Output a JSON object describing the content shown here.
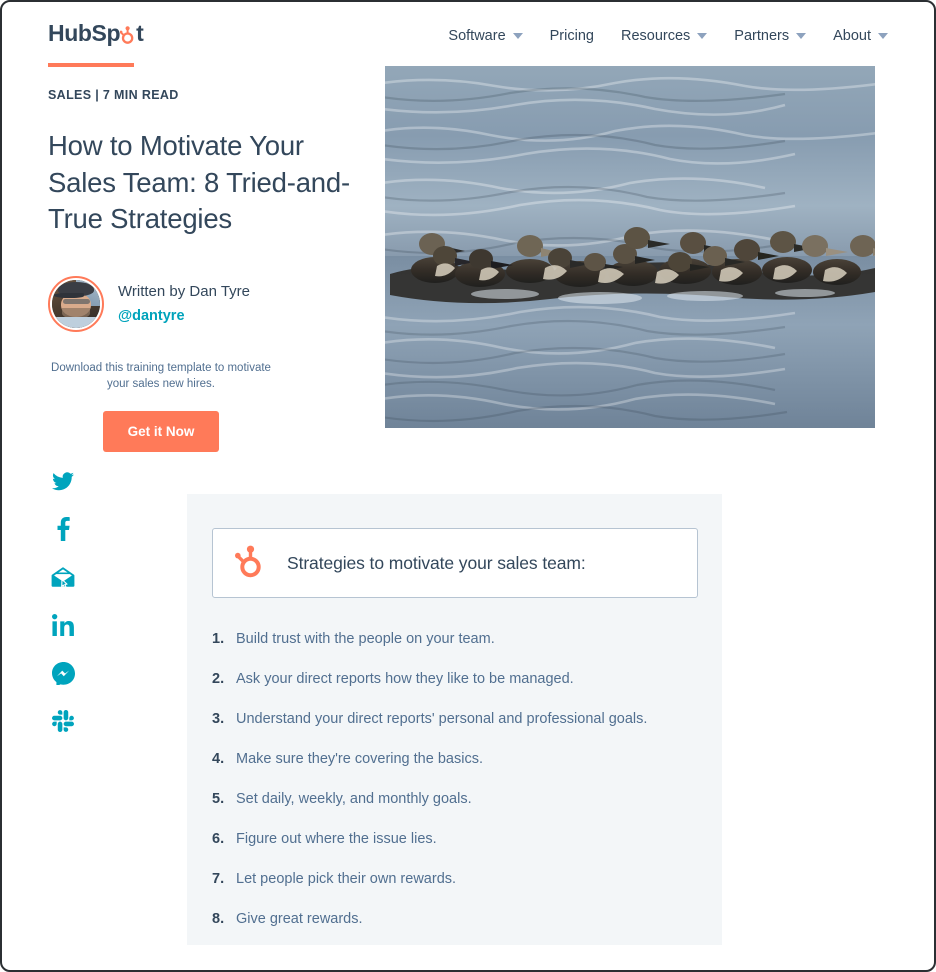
{
  "header": {
    "logo_text_before": "HubSp",
    "logo_text_after": "t",
    "logo_icon": "hubspot-sprocket-icon",
    "nav": [
      {
        "label": "Software",
        "has_caret": true
      },
      {
        "label": "Pricing",
        "has_caret": false
      },
      {
        "label": "Resources",
        "has_caret": true
      },
      {
        "label": "Partners",
        "has_caret": true
      },
      {
        "label": "About",
        "has_caret": true
      }
    ]
  },
  "article": {
    "kicker": "SALES | 7 MIN READ",
    "title": "How to Motivate Your Sales Team: 8 Tried-and-True Strategies",
    "author": {
      "written_by": "Written by Dan Tyre",
      "handle": "@dantyre"
    },
    "cta": {
      "text": "Download this training template to motivate your sales new hires.",
      "button_label": "Get it Now"
    }
  },
  "social": [
    {
      "name": "twitter-icon"
    },
    {
      "name": "facebook-icon"
    },
    {
      "name": "email-icon"
    },
    {
      "name": "linkedin-icon"
    },
    {
      "name": "messenger-icon"
    },
    {
      "name": "slack-icon"
    }
  ],
  "hero": {
    "alt": "Flock of ducks swimming together in a line on rippled blue-gray water"
  },
  "content": {
    "strategy_heading": "Strategies to motivate your sales team:",
    "strategy_icon": "hubspot-sprocket-icon",
    "list": [
      {
        "num": "1.",
        "text": "Build trust with the people on your team."
      },
      {
        "num": "2.",
        "text": "Ask your direct reports how they like to be managed."
      },
      {
        "num": "3.",
        "text": "Understand your direct reports' personal and professional goals."
      },
      {
        "num": "4.",
        "text": "Make sure they're covering the basics."
      },
      {
        "num": "5.",
        "text": "Set daily, weekly, and monthly goals."
      },
      {
        "num": "6.",
        "text": "Figure out where the issue lies."
      },
      {
        "num": "7.",
        "text": "Let people pick their own rewards."
      },
      {
        "num": "8.",
        "text": "Give great rewards."
      }
    ]
  },
  "colors": {
    "brand_orange": "#ff7a59",
    "navy": "#33475b",
    "slate": "#516f90",
    "teal": "#00a4bd",
    "handle_teal": "#00a3bb",
    "card_bg": "#f3f6f8",
    "box_border": "#b6c4d2"
  }
}
